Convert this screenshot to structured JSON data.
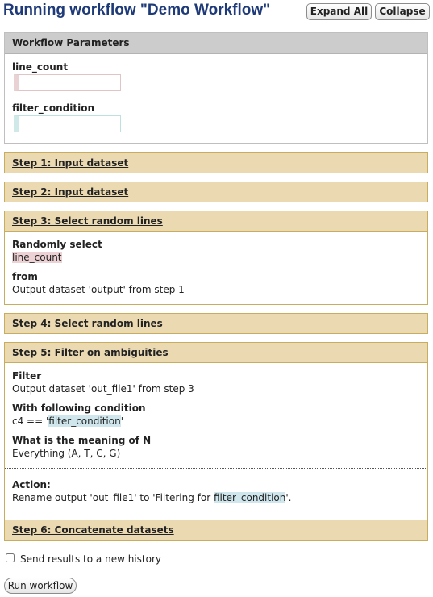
{
  "page": {
    "title": "Running workflow \"Demo Workflow\""
  },
  "header": {
    "expand_all_label": "Expand All",
    "collapse_label": "Collapse"
  },
  "parameters": {
    "heading": "Workflow Parameters",
    "fields": [
      {
        "label": "line_count",
        "value": ""
      },
      {
        "label": "filter_condition",
        "value": ""
      }
    ]
  },
  "steps": [
    {
      "title": "Step 1: Input dataset"
    },
    {
      "title": "Step 2: Input dataset"
    },
    {
      "title": "Step 3: Select random lines",
      "body": {
        "randomly_select_label": "Randomly select",
        "randomly_select_value": "line_count",
        "from_label": "from",
        "from_value": "Output dataset 'output' from step 1"
      }
    },
    {
      "title": "Step 4: Select random lines"
    },
    {
      "title": "Step 5: Filter on ambiguities",
      "body": {
        "filter_label": "Filter",
        "filter_value": "Output dataset 'out_file1' from step 3",
        "condition_label": "With following condition",
        "condition_prefix": "c4 == '",
        "condition_param": "filter_condition",
        "condition_suffix": "'",
        "meaning_label": "What is the meaning of N",
        "meaning_value": "Everything (A, T, C, G)",
        "action_label": "Action:",
        "action_prefix": "Rename output 'out_file1' to 'Filtering for ",
        "action_param": "filter_condition",
        "action_suffix": "'."
      }
    },
    {
      "title": "Step 6: Concatenate datasets"
    }
  ],
  "footer": {
    "new_history_label": "Send results to a new history",
    "new_history_checked": false,
    "run_label": "Run workflow"
  },
  "colors": {
    "title": "#1e3a78",
    "step_header": "#ebd9b2",
    "step_border": "#c9ad5e",
    "param_header": "#cccccc",
    "highlight_red": "#ecd2d4",
    "highlight_blue": "#cfe6ec"
  }
}
